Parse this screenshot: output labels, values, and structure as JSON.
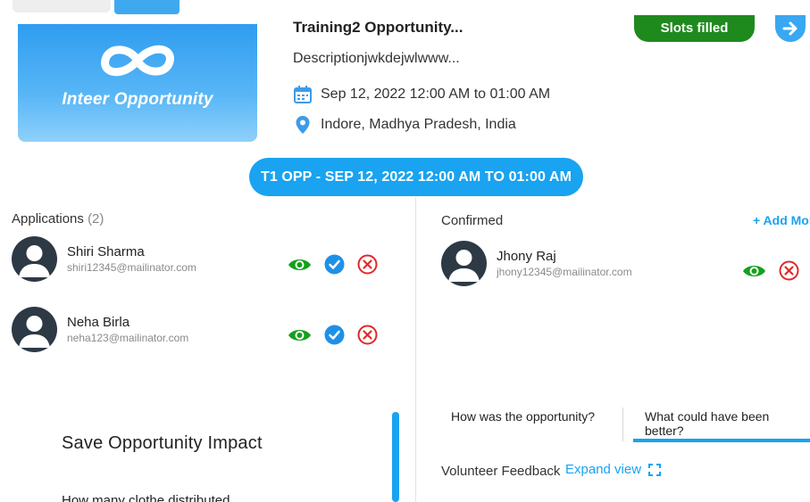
{
  "colors": {
    "accent": "#19a3f0",
    "success": "#1e8a1e",
    "danger": "#e0292b",
    "view": "#14a01c"
  },
  "banner": {
    "logo_icon": "infinity-logo-icon",
    "text": "Inteer Opportunity"
  },
  "opportunity": {
    "title": "Training2 Opportunity...",
    "description": "Descriptionjwkdejwlwww...",
    "date_text": "Sep 12, 2022 12:00 AM to 01:00 AM",
    "location_text": "Indore, Madhya Pradesh, India",
    "status_badge": "Slots filled"
  },
  "session": {
    "label": "T1 OPP - SEP 12, 2022 12:00 AM TO 01:00 AM"
  },
  "applications": {
    "title": "Applications",
    "count": "(2)",
    "items": [
      {
        "name": "Shiri Sharma",
        "email": "shiri12345@mailinator.com"
      },
      {
        "name": "Neha Birla",
        "email": "neha123@mailinator.com"
      }
    ]
  },
  "confirmed": {
    "title": "Confirmed",
    "add_more": "+ Add More",
    "items": [
      {
        "name": "Jhony Raj",
        "email": "jhony12345@mailinator.com"
      }
    ]
  },
  "impact": {
    "title": "Save Opportunity Impact",
    "question": "How many clothe distributed"
  },
  "feedback": {
    "tabs": [
      "How was the opportunity?",
      "What could have been better?"
    ],
    "active_tab": 1,
    "label": "Volunteer Feedback",
    "expand_label": "Expand view"
  }
}
